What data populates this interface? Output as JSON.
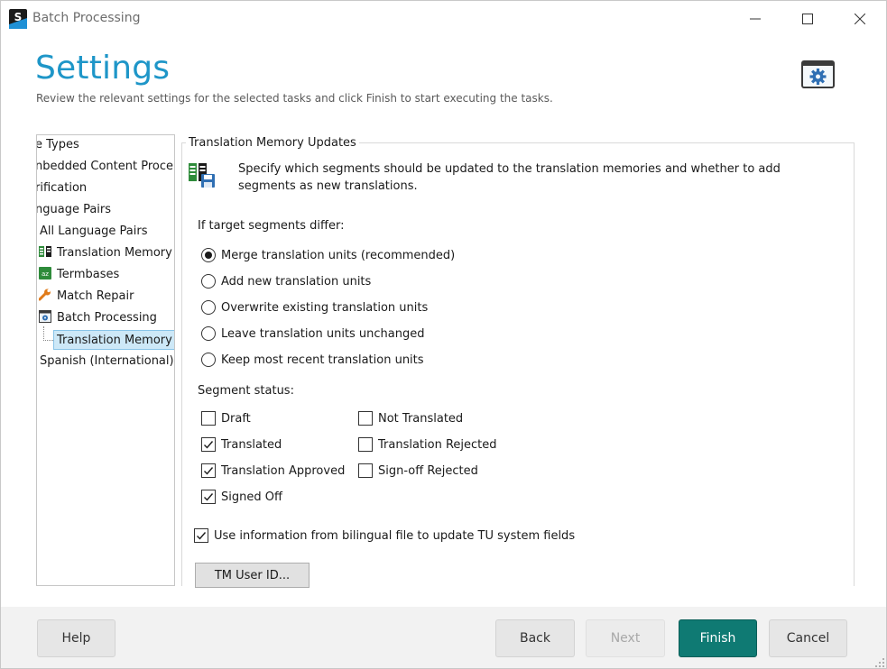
{
  "window": {
    "app_icon_letter": "S",
    "title": "Batch Processing",
    "controls": {
      "minimize": "minimize-icon",
      "maximize": "maximize-icon",
      "close": "close-icon"
    }
  },
  "header": {
    "title": "Settings",
    "subtitle": "Review the relevant settings for the selected tasks and click Finish to start executing the tasks.",
    "icon": "settings-window-icon"
  },
  "tree": {
    "items": [
      {
        "label": "e Types",
        "icon": ""
      },
      {
        "label": "nbedded Content Proce",
        "icon": ""
      },
      {
        "label": "rification",
        "icon": ""
      },
      {
        "label": "nguage Pairs",
        "icon": ""
      },
      {
        "label": "All Language Pairs",
        "icon": ""
      },
      {
        "label": "Translation Memory",
        "icon": "translation-memory-icon"
      },
      {
        "label": "Termbases",
        "icon": "termbase-icon"
      },
      {
        "label": "Match Repair",
        "icon": "wrench-icon"
      },
      {
        "label": "Batch Processing",
        "icon": "batch-processing-icon"
      },
      {
        "label": "Translation Memory",
        "icon": "",
        "selected": true
      },
      {
        "label": "Spanish (International)-",
        "icon": ""
      }
    ]
  },
  "panel": {
    "group_title": "Translation Memory Updates",
    "description": "Specify which segments should be updated to the translation memories and whether to add segments as new translations.",
    "differ_label": "If target segments differ:",
    "options": [
      {
        "label": "Merge translation units (recommended)",
        "checked": true
      },
      {
        "label": "Add new translation units",
        "checked": false
      },
      {
        "label": "Overwrite existing translation units",
        "checked": false
      },
      {
        "label": "Leave translation units unchanged",
        "checked": false
      },
      {
        "label": "Keep most recent translation units",
        "checked": false
      }
    ],
    "status_label": "Segment status:",
    "status_left": [
      {
        "label": "Draft",
        "checked": false
      },
      {
        "label": "Translated",
        "checked": true
      },
      {
        "label": "Translation Approved",
        "checked": true
      },
      {
        "label": "Signed Off",
        "checked": true
      }
    ],
    "status_right": [
      {
        "label": "Not Translated",
        "checked": false
      },
      {
        "label": "Translation Rejected",
        "checked": false
      },
      {
        "label": "Sign-off Rejected",
        "checked": false
      }
    ],
    "bilingual": {
      "label": "Use information from bilingual file to update TU system fields",
      "checked": true
    },
    "tm_user_id_button": "TM User ID..."
  },
  "footer": {
    "help": "Help",
    "back": "Back",
    "next": "Next",
    "finish": "Finish",
    "cancel": "Cancel"
  },
  "colors": {
    "title_blue": "#1e96c8",
    "finish_teal": "#0f7a73",
    "tree_selected": "#cde8f7"
  }
}
